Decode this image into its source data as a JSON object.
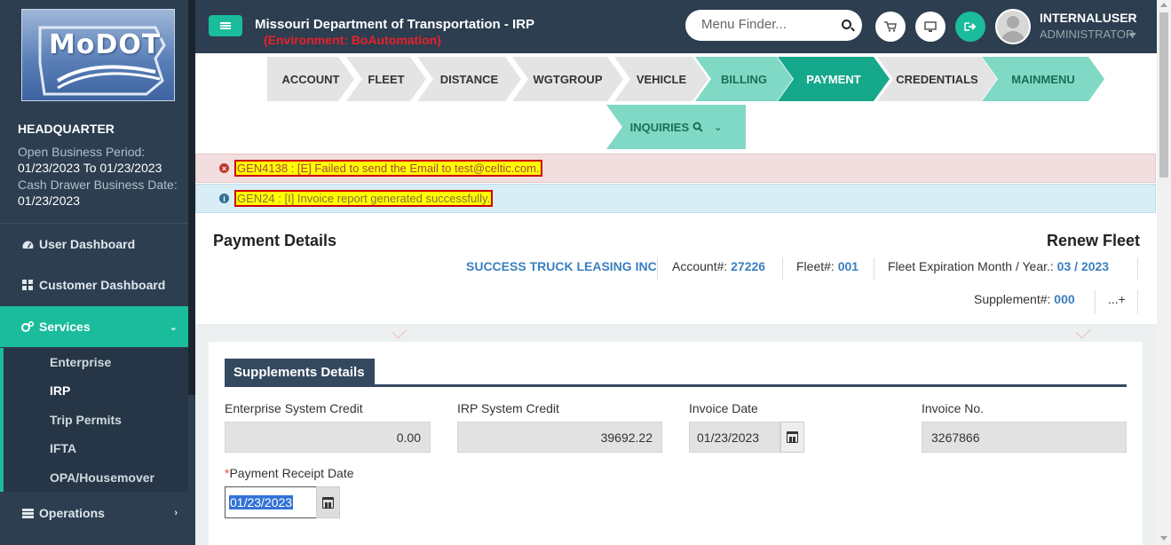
{
  "header": {
    "title": "Missouri Department of Transportation - IRP",
    "environment": "(Environment: BoAutomation)",
    "search_placeholder": "Menu Finder...",
    "user_name": "INTERNALUSER",
    "user_role": "ADMINISTRATOR"
  },
  "sidebar": {
    "logo_text": "MoDOT",
    "office": "HEADQUARTER",
    "open_period_label": "Open Business Period:",
    "open_period_value": "01/23/2023 To 01/23/2023",
    "cash_drawer_label": "Cash Drawer Business Date:",
    "cash_drawer_value": "01/23/2023",
    "nav": [
      {
        "label": "User Dashboard",
        "icon": "dashboard-icon"
      },
      {
        "label": "Customer Dashboard",
        "icon": "grid-icon"
      },
      {
        "label": "Services",
        "icon": "cogs-icon"
      },
      {
        "label": "Operations",
        "icon": "list-icon"
      }
    ],
    "services_sub": [
      "Enterprise",
      "IRP",
      "Trip Permits",
      "IFTA",
      "OPA/Housemover"
    ]
  },
  "workflow": {
    "steps": [
      "ACCOUNT",
      "FLEET",
      "DISTANCE",
      "WGTGROUP",
      "VEHICLE",
      "BILLING",
      "PAYMENT",
      "CREDENTIALS",
      "MAINMENU"
    ],
    "inquiries": "INQUIRIES"
  },
  "alerts": {
    "error": "GEN4138 : [E] Failed to send the Email to test@celtic.com.",
    "info": "GEN24 : [I] Invoice report generated successfully."
  },
  "payment": {
    "title": "Payment Details",
    "subtitle": "Renew Fleet",
    "company": "SUCCESS TRUCK LEASING INC",
    "account_label": "Account#:",
    "account_value": "27226",
    "fleet_label": "Fleet#:",
    "fleet_value": "001",
    "expiration_label": "Fleet Expiration Month / Year.:",
    "expiration_value": "03 / 2023",
    "supplement_label": "Supplement#:",
    "supplement_value": "000",
    "more": "...+"
  },
  "supplements": {
    "title": "Supplements Details",
    "enterprise_credit_label": "Enterprise System Credit",
    "enterprise_credit_value": "0.00",
    "irp_credit_label": "IRP System Credit",
    "irp_credit_value": "39692.22",
    "invoice_date_label": "Invoice Date",
    "invoice_date_value": "01/23/2023",
    "invoice_no_label": "Invoice No.",
    "invoice_no_value": "3267866",
    "receipt_date_label": "Payment Receipt Date",
    "receipt_date_required": "*",
    "receipt_date_value": "01/23/2023"
  },
  "colors": {
    "sidebar": "#2c3e50",
    "accent": "#1abc9c",
    "step_light": "#7fd9c4",
    "step_active": "#16a88b",
    "error_text": "#e8202a"
  }
}
